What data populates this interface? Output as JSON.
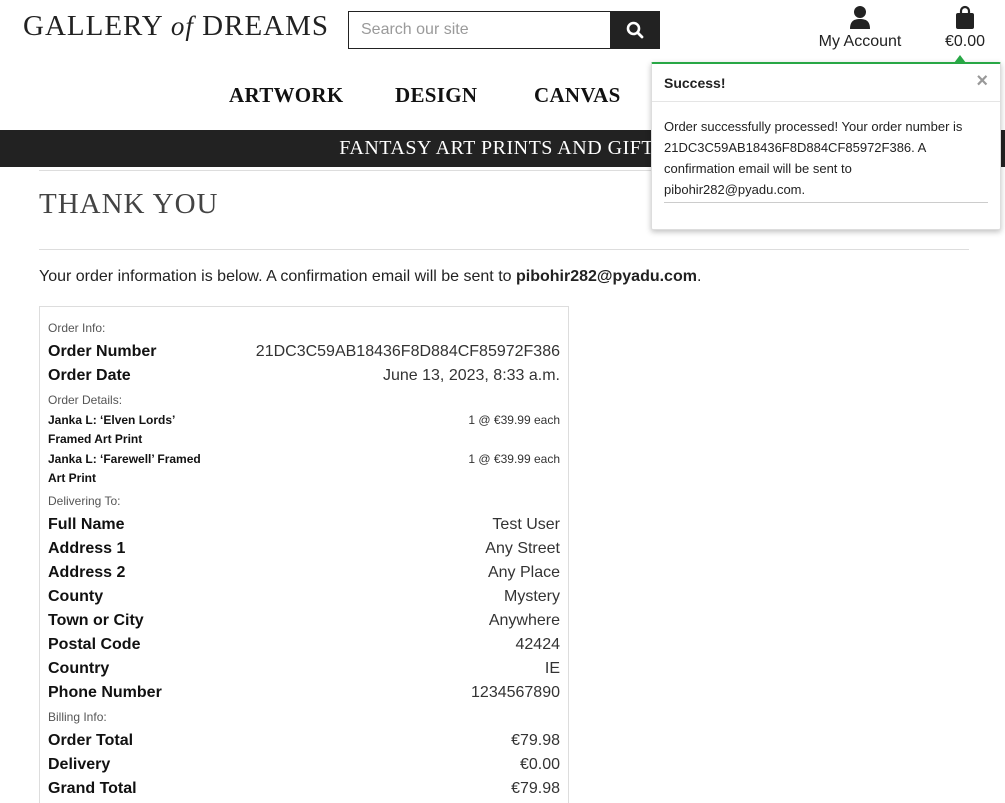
{
  "header": {
    "logo_main": "GALLERY",
    "logo_of": "of",
    "logo_end": "DREAMS",
    "search_placeholder": "Search our site",
    "account_label": "My Account",
    "bag_total": "€0.00"
  },
  "nav": {
    "items": [
      "ARTWORK",
      "DESIGN",
      "CANVAS"
    ]
  },
  "banner": {
    "text": "FANTASY ART PRINTS AND GIFTS"
  },
  "main": {
    "title": "THANK YOU",
    "intro_text": "Your order information is below. A confirmation email will be sent to ",
    "email": "pibohir282@pyadu.com",
    "intro_end": "."
  },
  "order": {
    "sections": {
      "info": "Order Info:",
      "details": "Order Details:",
      "delivering": "Delivering To:",
      "billing": "Billing Info:"
    },
    "info_rows": [
      {
        "label": "Order Number",
        "value": "21DC3C59AB18436F8D884CF85972F386"
      },
      {
        "label": "Order Date",
        "value": "June 13, 2023, 8:33 a.m."
      }
    ],
    "items": [
      {
        "name": "Janka L: ‘Elven Lords’ Framed Art Print",
        "qty": "1 @ €39.99 each"
      },
      {
        "name": "Janka L: ‘Farewell’ Framed Art Print",
        "qty": "1 @ €39.99 each"
      }
    ],
    "delivery_rows": [
      {
        "label": "Full Name",
        "value": "Test User"
      },
      {
        "label": "Address 1",
        "value": "Any Street"
      },
      {
        "label": "Address 2",
        "value": "Any Place"
      },
      {
        "label": "County",
        "value": "Mystery"
      },
      {
        "label": "Town or City",
        "value": "Anywhere"
      },
      {
        "label": "Postal Code",
        "value": "42424"
      },
      {
        "label": "Country",
        "value": "IE"
      },
      {
        "label": "Phone Number",
        "value": "1234567890"
      }
    ],
    "billing_rows": [
      {
        "label": "Order Total",
        "value": "€79.98"
      },
      {
        "label": "Delivery",
        "value": "€0.00"
      },
      {
        "label": "Grand Total",
        "value": "€79.98"
      }
    ]
  },
  "toast": {
    "title": "Success!",
    "close": "×",
    "message": "Order successfully processed! Your order number is 21DC3C59AB18436F8D884CF85972F386. A confirmation email will be sent to pibohir282@pyadu.com."
  },
  "colors": {
    "dark": "#222222",
    "success": "#28a745"
  },
  "icons": [
    "search-icon",
    "user-icon",
    "shopping-bag-icon",
    "close-icon"
  ]
}
